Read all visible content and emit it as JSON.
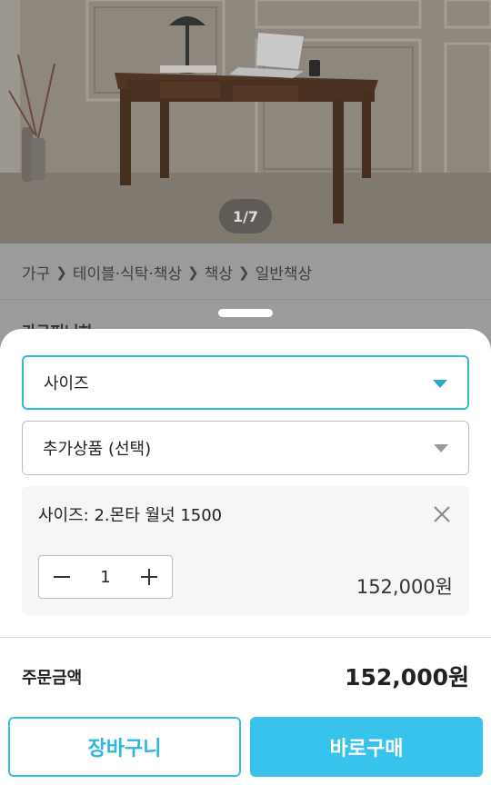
{
  "product_image": {
    "pager": "1/7",
    "icons": [
      "desk-photo"
    ]
  },
  "breadcrumb": {
    "items": [
      "가구",
      "테이블·식탁·책상",
      "책상",
      "일반책상"
    ],
    "separator_icon": "chevron-right-icon"
  },
  "brand_peek": "가구피니하",
  "options": {
    "size_placeholder": "사이즈",
    "addon_placeholder": "추가상품 (선택)",
    "selected": {
      "label": "사이즈: 2.몬타 월넛 1500",
      "quantity": "1",
      "price": "152,000원"
    }
  },
  "total": {
    "label": "주문금액",
    "value": "152,000원"
  },
  "buttons": {
    "cart": "장바구니",
    "buy": "바로구매"
  },
  "colors": {
    "accent": "#38c3ec",
    "accent_border": "#35b8d6",
    "cart_text": "#2db6df"
  }
}
